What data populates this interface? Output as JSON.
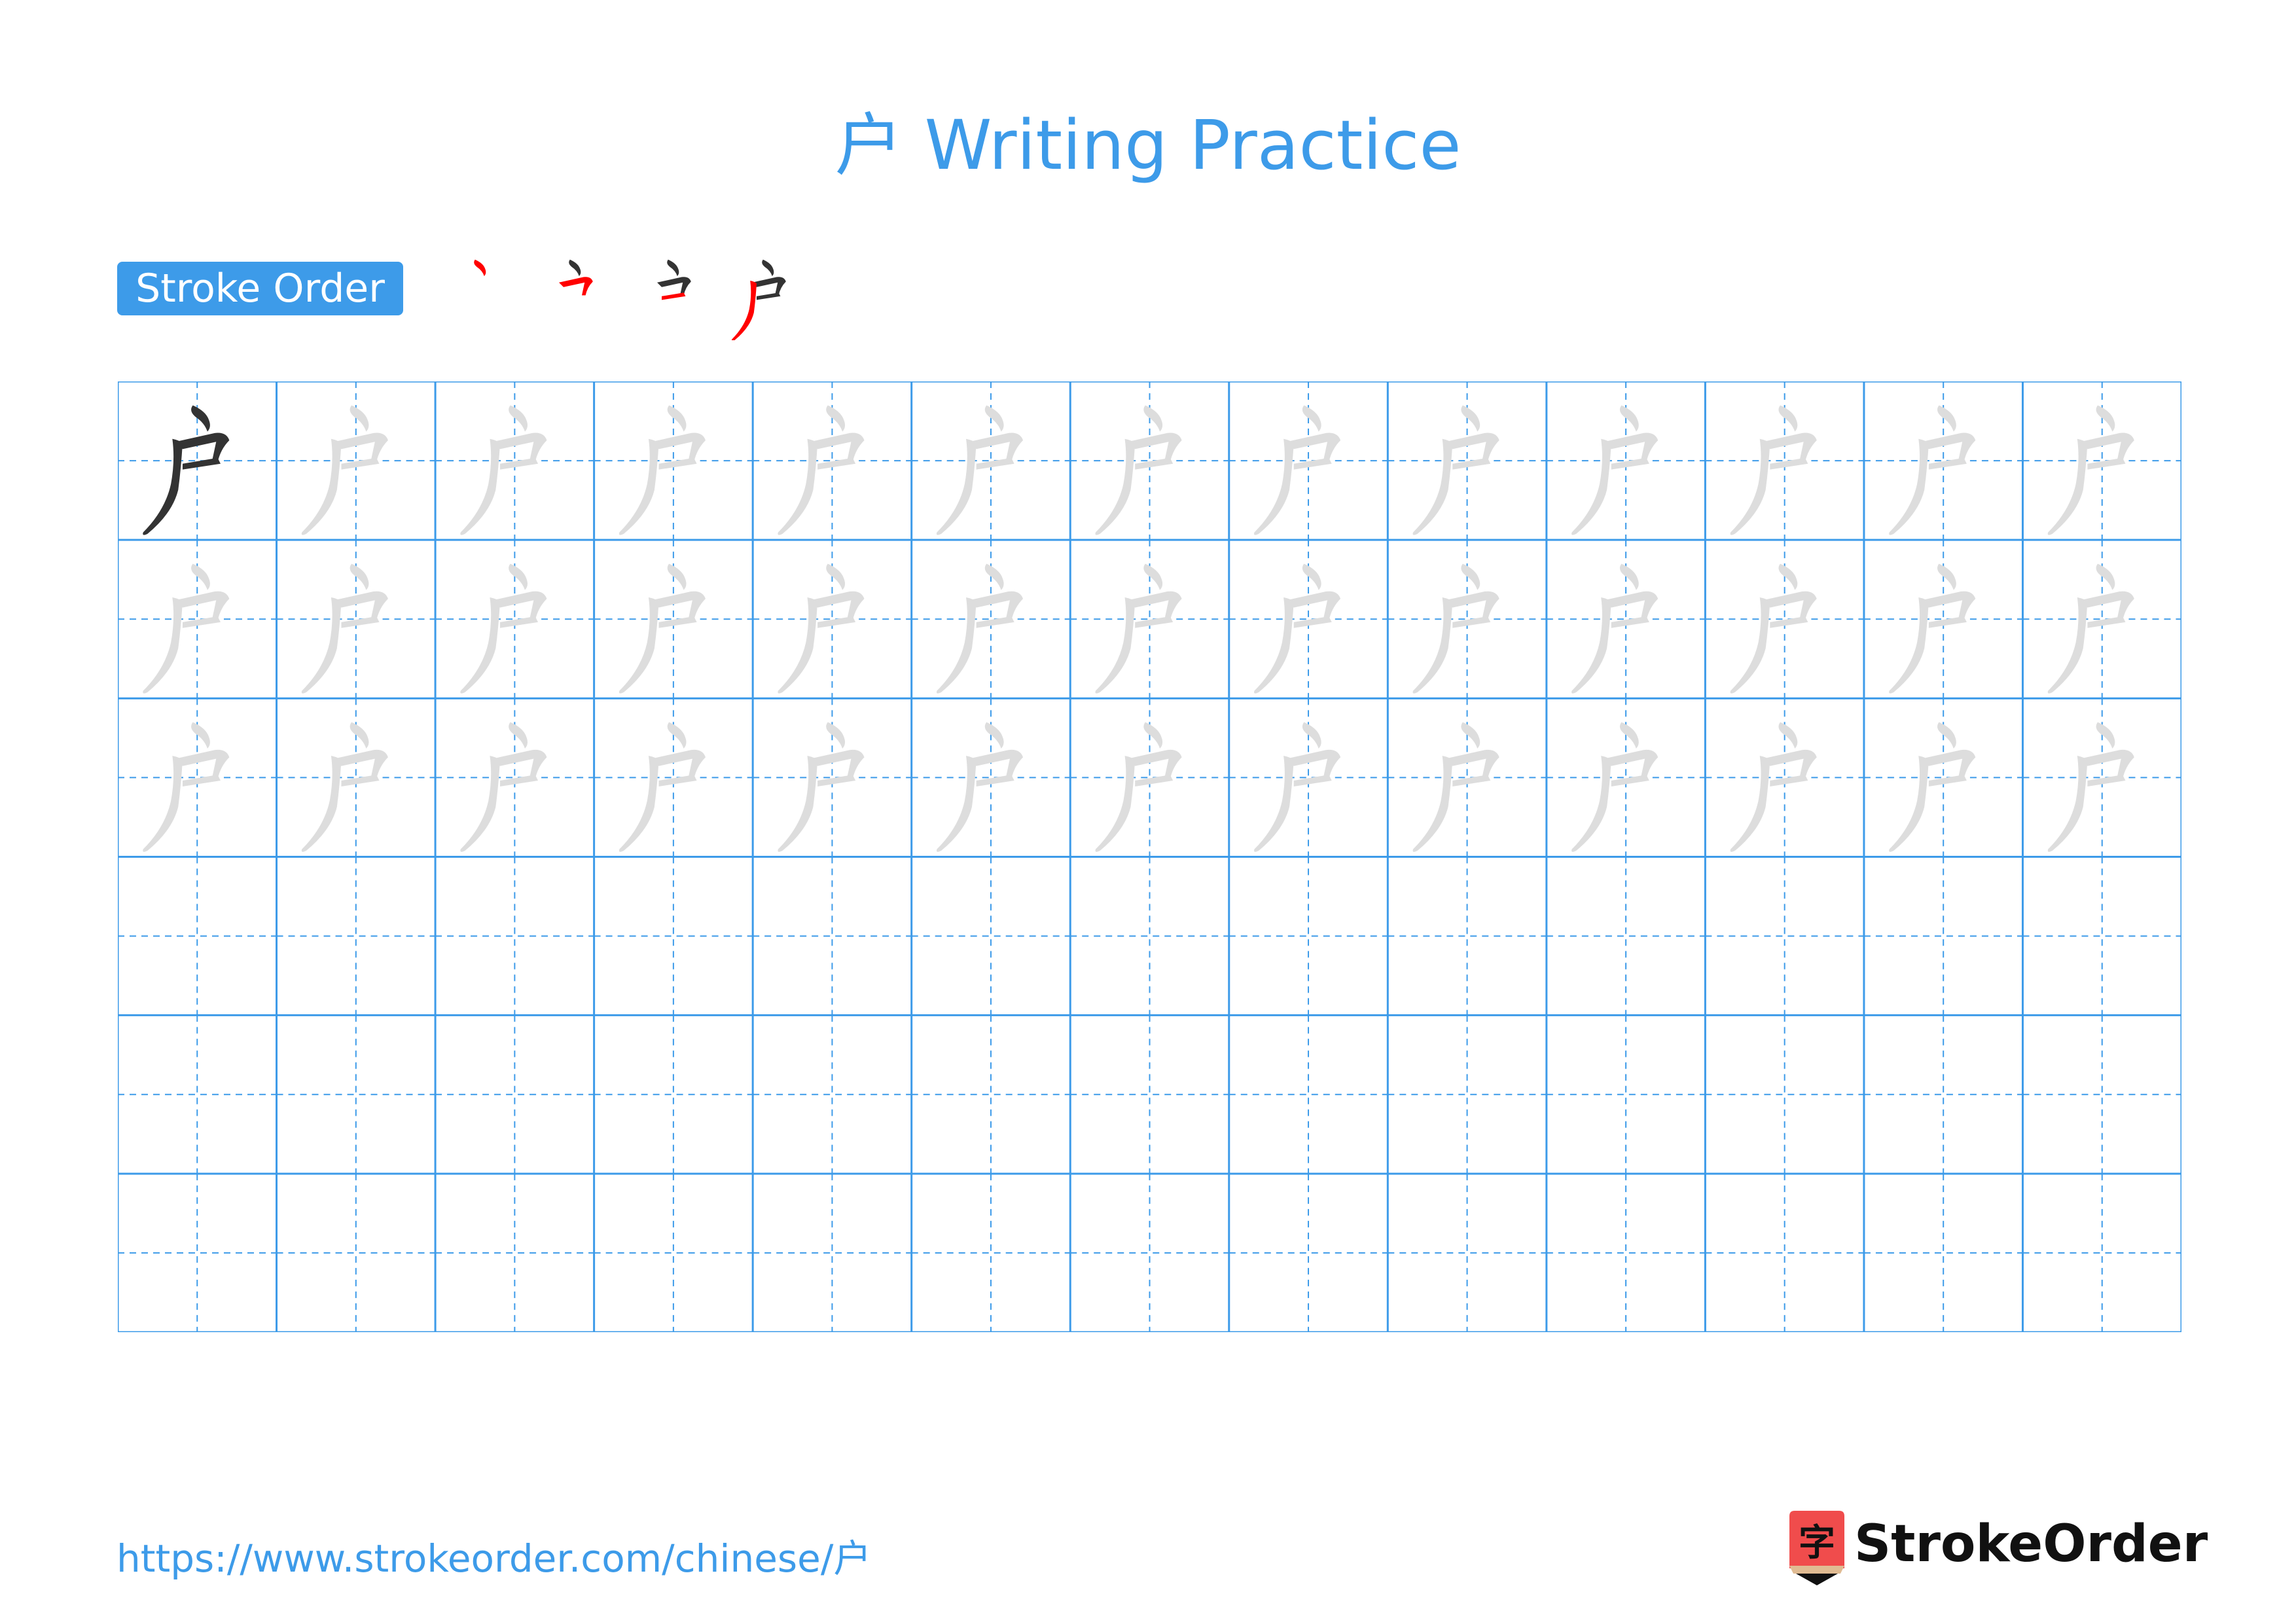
{
  "header": {
    "character": "户",
    "title": "户 Writing Practice"
  },
  "stroke_order": {
    "label": "Stroke Order",
    "steps": 4,
    "active_color": "#ff0000",
    "done_color": "#333333"
  },
  "grid": {
    "rows": 6,
    "cols": 13,
    "solid_rows": 1,
    "traced_rows": 3,
    "line_color": "#3d9be9",
    "solid_color": "#333333",
    "trace_color": "#dddddd"
  },
  "footer": {
    "url": "https://www.strokeorder.com/chinese/户",
    "brand": "StrokeOrder",
    "logo_glyph": "字",
    "logo_color": "#f04c4c"
  }
}
